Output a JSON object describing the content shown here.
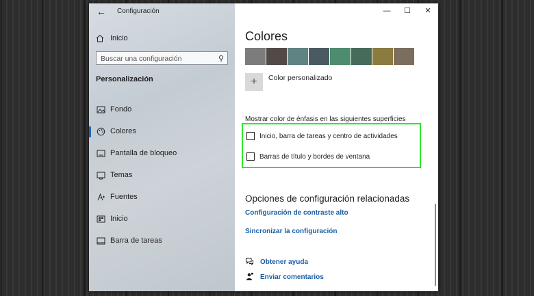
{
  "window": {
    "title": "Configuración"
  },
  "sidebar": {
    "home_label": "Inicio",
    "search_placeholder": "Buscar una configuración",
    "section_title": "Personalización",
    "items": [
      {
        "label": "Fondo",
        "icon": "image-icon"
      },
      {
        "label": "Colores",
        "icon": "palette-icon",
        "active": true
      },
      {
        "label": "Pantalla de bloqueo",
        "icon": "lock-screen-icon"
      },
      {
        "label": "Temas",
        "icon": "brush-icon"
      },
      {
        "label": "Fuentes",
        "icon": "font-icon"
      },
      {
        "label": "Inicio",
        "icon": "start-icon"
      },
      {
        "label": "Barra de tareas",
        "icon": "taskbar-icon"
      }
    ]
  },
  "main": {
    "title": "Colores",
    "swatches": [
      "#7c7c7c",
      "#514a47",
      "#5f8282",
      "#4a5a61",
      "#4d8c6c",
      "#466b5b",
      "#8a7b40",
      "#7c6e5e"
    ],
    "custom_color_label": "Color personalizado",
    "surface_label": "Mostrar color de énfasis en las siguientes superficies",
    "checkboxes": [
      {
        "label": "Inicio, barra de tareas y centro de actividades",
        "checked": false
      },
      {
        "label": "Barras de título y bordes de ventana",
        "checked": false
      }
    ],
    "related_title": "Opciones de configuración relacionadas",
    "related_links": [
      "Configuración de contraste alto",
      "Sincronizar la configuración"
    ],
    "help_links": [
      "Obtener ayuda",
      "Enviar comentarios"
    ]
  },
  "colors": {
    "accent": "#1a5ea6",
    "highlight": "#2ee82a"
  }
}
